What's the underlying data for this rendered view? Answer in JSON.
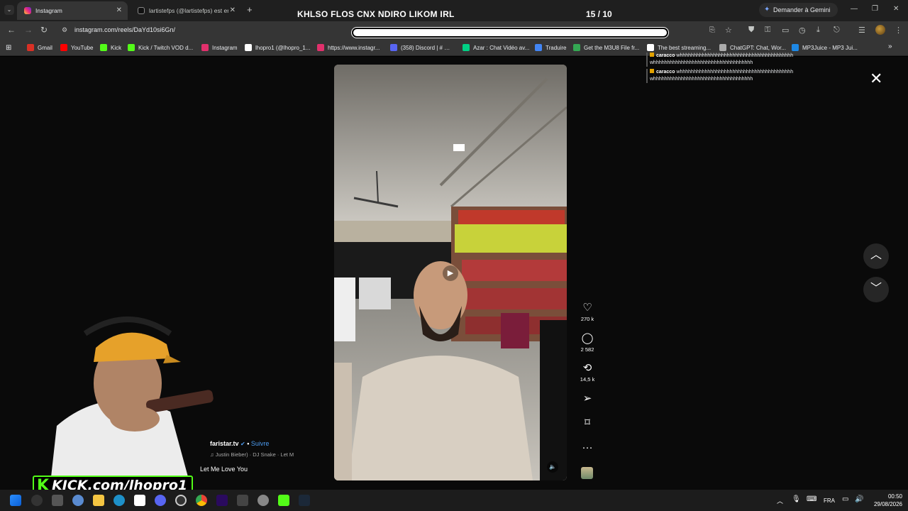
{
  "tabs": [
    {
      "label": "Instagram",
      "active": true
    },
    {
      "label": "lartistefps (@lartistefps) est en",
      "active": false
    }
  ],
  "stream_overlay": {
    "title": "KHLSO FLOS CNX NDIRO LIKOM IRL",
    "counter": "15 / 10"
  },
  "gemini_label": "Demander à Gemini",
  "address_bar": {
    "url": "instagram.com/reels/DaYd10si6Gn/"
  },
  "bookmarks": [
    {
      "label": "Gmail",
      "color": "#d93025"
    },
    {
      "label": "YouTube",
      "color": "#ff0000"
    },
    {
      "label": "Kick",
      "color": "#53fc18"
    },
    {
      "label": "Kick / Twitch VOD d...",
      "color": "#53fc18"
    },
    {
      "label": "Instagram",
      "color": "#e1306c"
    },
    {
      "label": "lhopro1 (@lhopro_1...",
      "color": "#ffffff"
    },
    {
      "label": "https://www.instagr...",
      "color": "#e1306c"
    },
    {
      "label": "(358) Discord | # …",
      "color": "#5865f2"
    },
    {
      "label": "Azar : Chat Vidéo av...",
      "color": "#00d084"
    },
    {
      "label": "Traduire",
      "color": "#4285f4"
    },
    {
      "label": "Get the M3U8 File fr...",
      "color": "#34a853"
    },
    {
      "label": "The best streaming...",
      "color": "#ffffff"
    },
    {
      "label": "ChatGPT: Chat, Wor...",
      "color": "#aaaaaa"
    },
    {
      "label": "MP3Juice - MP3 Jui...",
      "color": "#1e88e5"
    }
  ],
  "chat": [
    {
      "user": "caracco",
      "message": "whhhhhhhhhhhhhhhhhhhhhhhhhhhhhhhhhhhhhhhhh whhhhhhhhhhhhhhhhhhhhhhhhhhhhhhhhhhhh"
    },
    {
      "user": "caracco",
      "message": "whhhhhhhhhhhhhhhhhhhhhhhhhhhhhhhhhhhhhhhhh whhhhhhhhhhhhhhhhhhhhhhhhhhhhhhhhhhhh"
    }
  ],
  "reel": {
    "author": "faristar.tv",
    "follow_label": "Suivre",
    "music": "Justin Bieber) · DJ Snake · Let M",
    "caption": "Let Me Love You",
    "likes": "270 k",
    "comments": "2 582",
    "reposts": "14,5 k"
  },
  "stream_logo_text": "KICK.com/lhopro1",
  "taskbar": {
    "lang": "FRA",
    "time": "00:50",
    "date": "29/08/2026"
  },
  "accent_colors": {
    "kick_green": "#53fc18",
    "follow_blue": "#4c9cf0"
  }
}
